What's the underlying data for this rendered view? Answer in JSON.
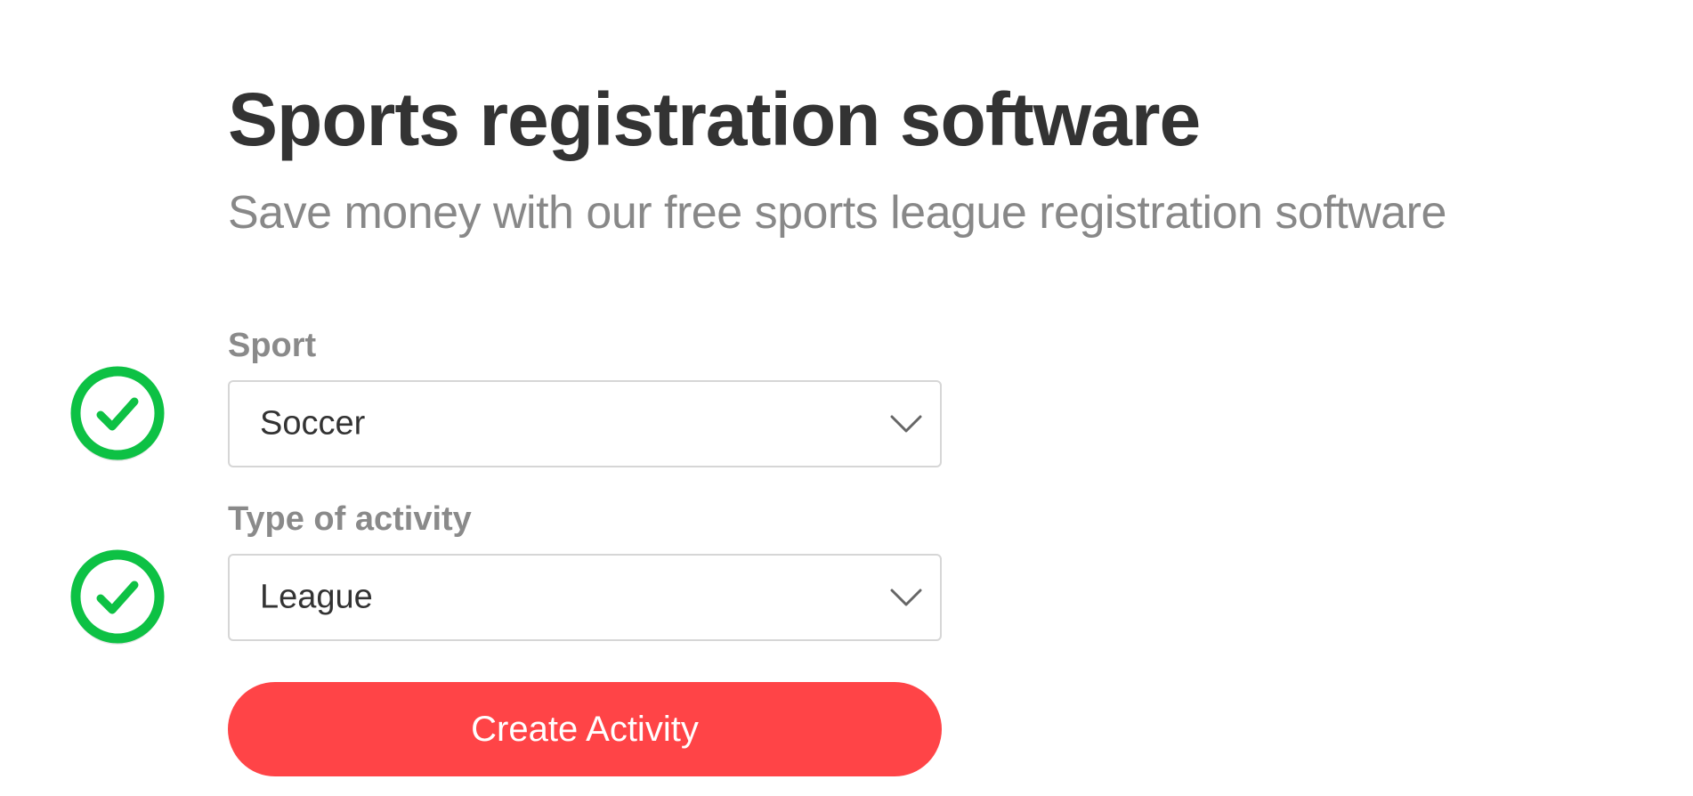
{
  "hero": {
    "title": "Sports registration software",
    "subtitle": "Save money with our free sports league registration software"
  },
  "form": {
    "sport": {
      "label": "Sport",
      "selected": "Soccer",
      "valid": true
    },
    "activity_type": {
      "label": "Type of activity",
      "selected": "League",
      "valid": true
    },
    "submit_label": "Create Activity"
  },
  "colors": {
    "title": "#333333",
    "subtitle": "#888888",
    "label": "#8a8a8a",
    "check_green": "#0dc144",
    "button_red": "#ff4447",
    "border": "#d6d6d6"
  },
  "icons": {
    "valid_indicator": "check-circle-icon",
    "dropdown_indicator": "chevron-down-icon"
  }
}
